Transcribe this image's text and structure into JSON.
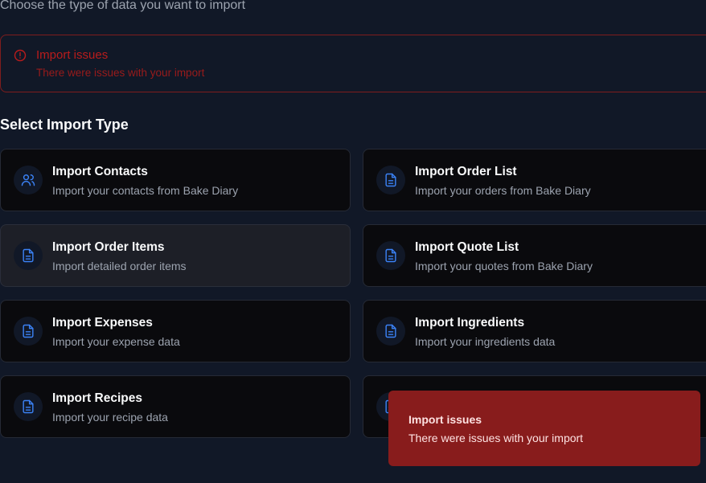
{
  "header": {
    "subtitle": "Choose the type of data you want to import"
  },
  "alert": {
    "icon": "alert-circle-icon",
    "title": "Import issues",
    "description": "There were issues with your import"
  },
  "section": {
    "title": "Select Import Type"
  },
  "import_types": [
    {
      "title": "Import Contacts",
      "description": "Import your contacts from Bake Diary",
      "icon": "users-icon"
    },
    {
      "title": "Import Order List",
      "description": "Import your orders from Bake Diary",
      "icon": "document-icon"
    },
    {
      "title": "Import Order Items",
      "description": "Import detailed order items",
      "icon": "document-icon"
    },
    {
      "title": "Import Quote List",
      "description": "Import your quotes from Bake Diary",
      "icon": "document-icon"
    },
    {
      "title": "Import Expenses",
      "description": "Import your expense data",
      "icon": "document-icon"
    },
    {
      "title": "Import Ingredients",
      "description": "Import your ingredients data",
      "icon": "document-icon"
    },
    {
      "title": "Import Recipes",
      "description": "Import your recipe data",
      "icon": "document-icon"
    }
  ],
  "toast": {
    "title": "Import issues",
    "description": "There were issues with your import"
  },
  "colors": {
    "background": "#111827",
    "card": "#0a0a0d",
    "accent": "#3b82f6",
    "error": "#b91c1c",
    "toast": "#881c1c"
  }
}
